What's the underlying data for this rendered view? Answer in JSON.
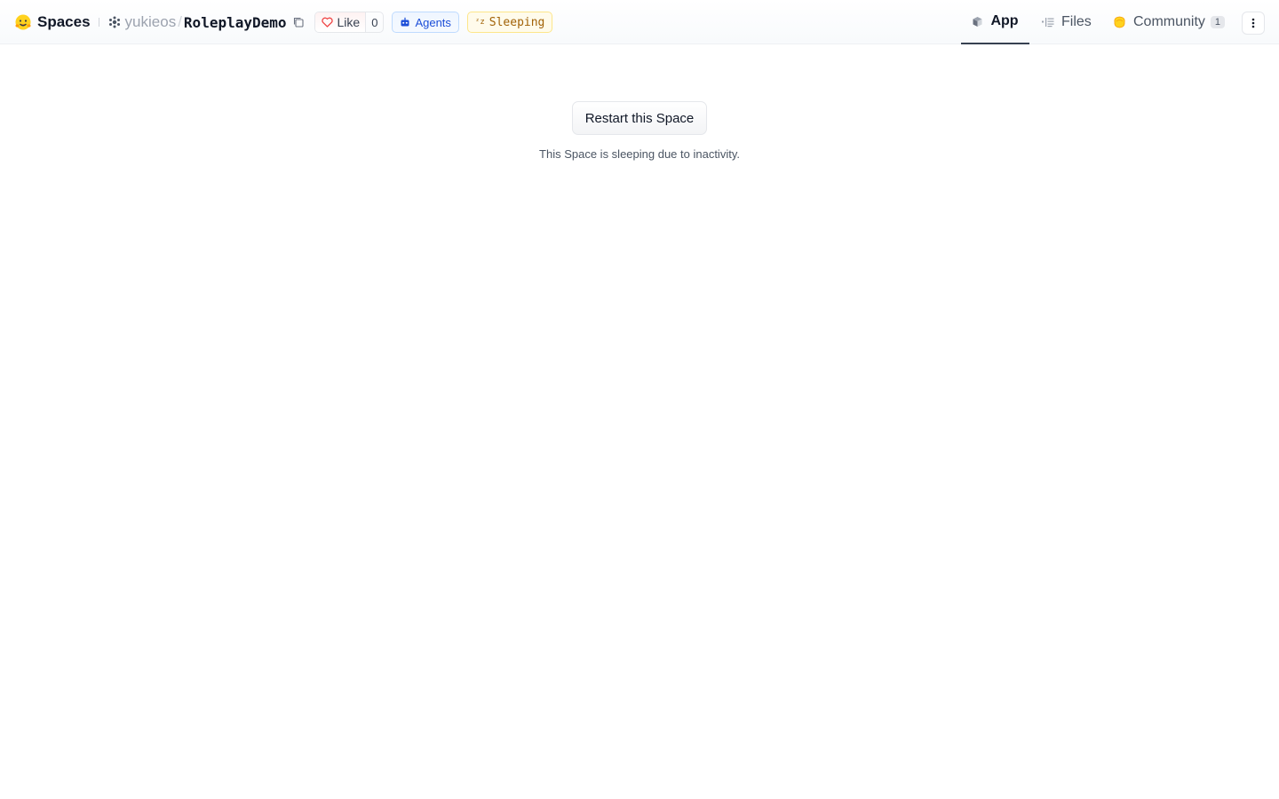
{
  "header": {
    "brand_label": "Spaces",
    "owner": "yukieos",
    "separator": "/",
    "repo_name": "RoleplayDemo",
    "like_label": "Like",
    "like_count": "0",
    "agents_label": "Agents",
    "status_label": "Sleeping"
  },
  "tabs": [
    {
      "label": "App",
      "icon": "app-cube-icon",
      "active": true
    },
    {
      "label": "Files",
      "icon": "files-icon",
      "active": false
    },
    {
      "label": "Community",
      "icon": "community-icon",
      "active": false,
      "count": "1"
    }
  ],
  "main": {
    "restart_label": "Restart this Space",
    "sleep_message": "This Space is sleeping due to inactivity."
  },
  "colors": {
    "brand_yellow": "#FFD21E",
    "agents_blue": "#1d4ed8",
    "sleep_amber": "#a16207",
    "like_red": "#ef4444"
  }
}
